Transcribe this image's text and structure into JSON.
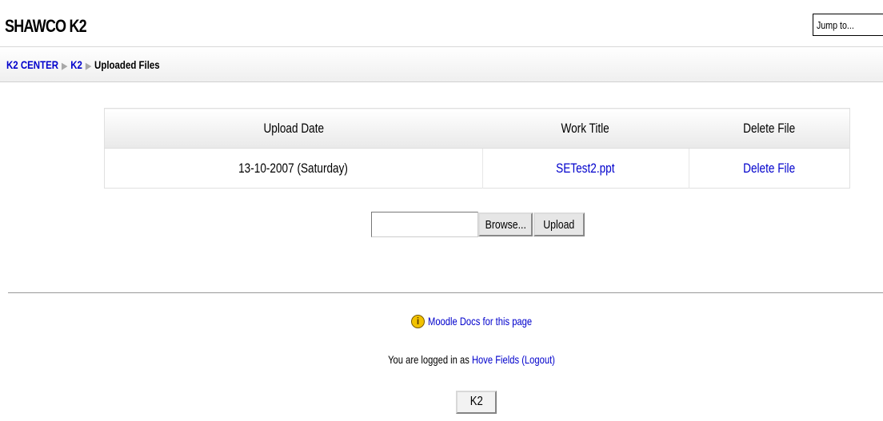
{
  "header": {
    "site_title": "SHAWCO K2",
    "jump_to": "Jump to..."
  },
  "breadcrumb": {
    "items": [
      "K2 CENTER",
      "K2"
    ],
    "current": "Uploaded Files"
  },
  "table": {
    "headers": [
      "Upload Date",
      "Work Title",
      "Delete File"
    ],
    "rows": [
      {
        "date": "13-10-2007 (Saturday)",
        "title": "SETest2.ppt",
        "action": "Delete File"
      }
    ]
  },
  "upload": {
    "browse_label": "Browse...",
    "upload_label": "Upload"
  },
  "footer": {
    "docs_link": "Moodle Docs for this page",
    "login_prefix": "You are logged in as",
    "user_name": "Hove Fields",
    "logout_label": "(Logout)",
    "home_button": "K2"
  },
  "icons": {
    "docs": "info-icon",
    "breadcrumb_separator": "triangle-right"
  }
}
